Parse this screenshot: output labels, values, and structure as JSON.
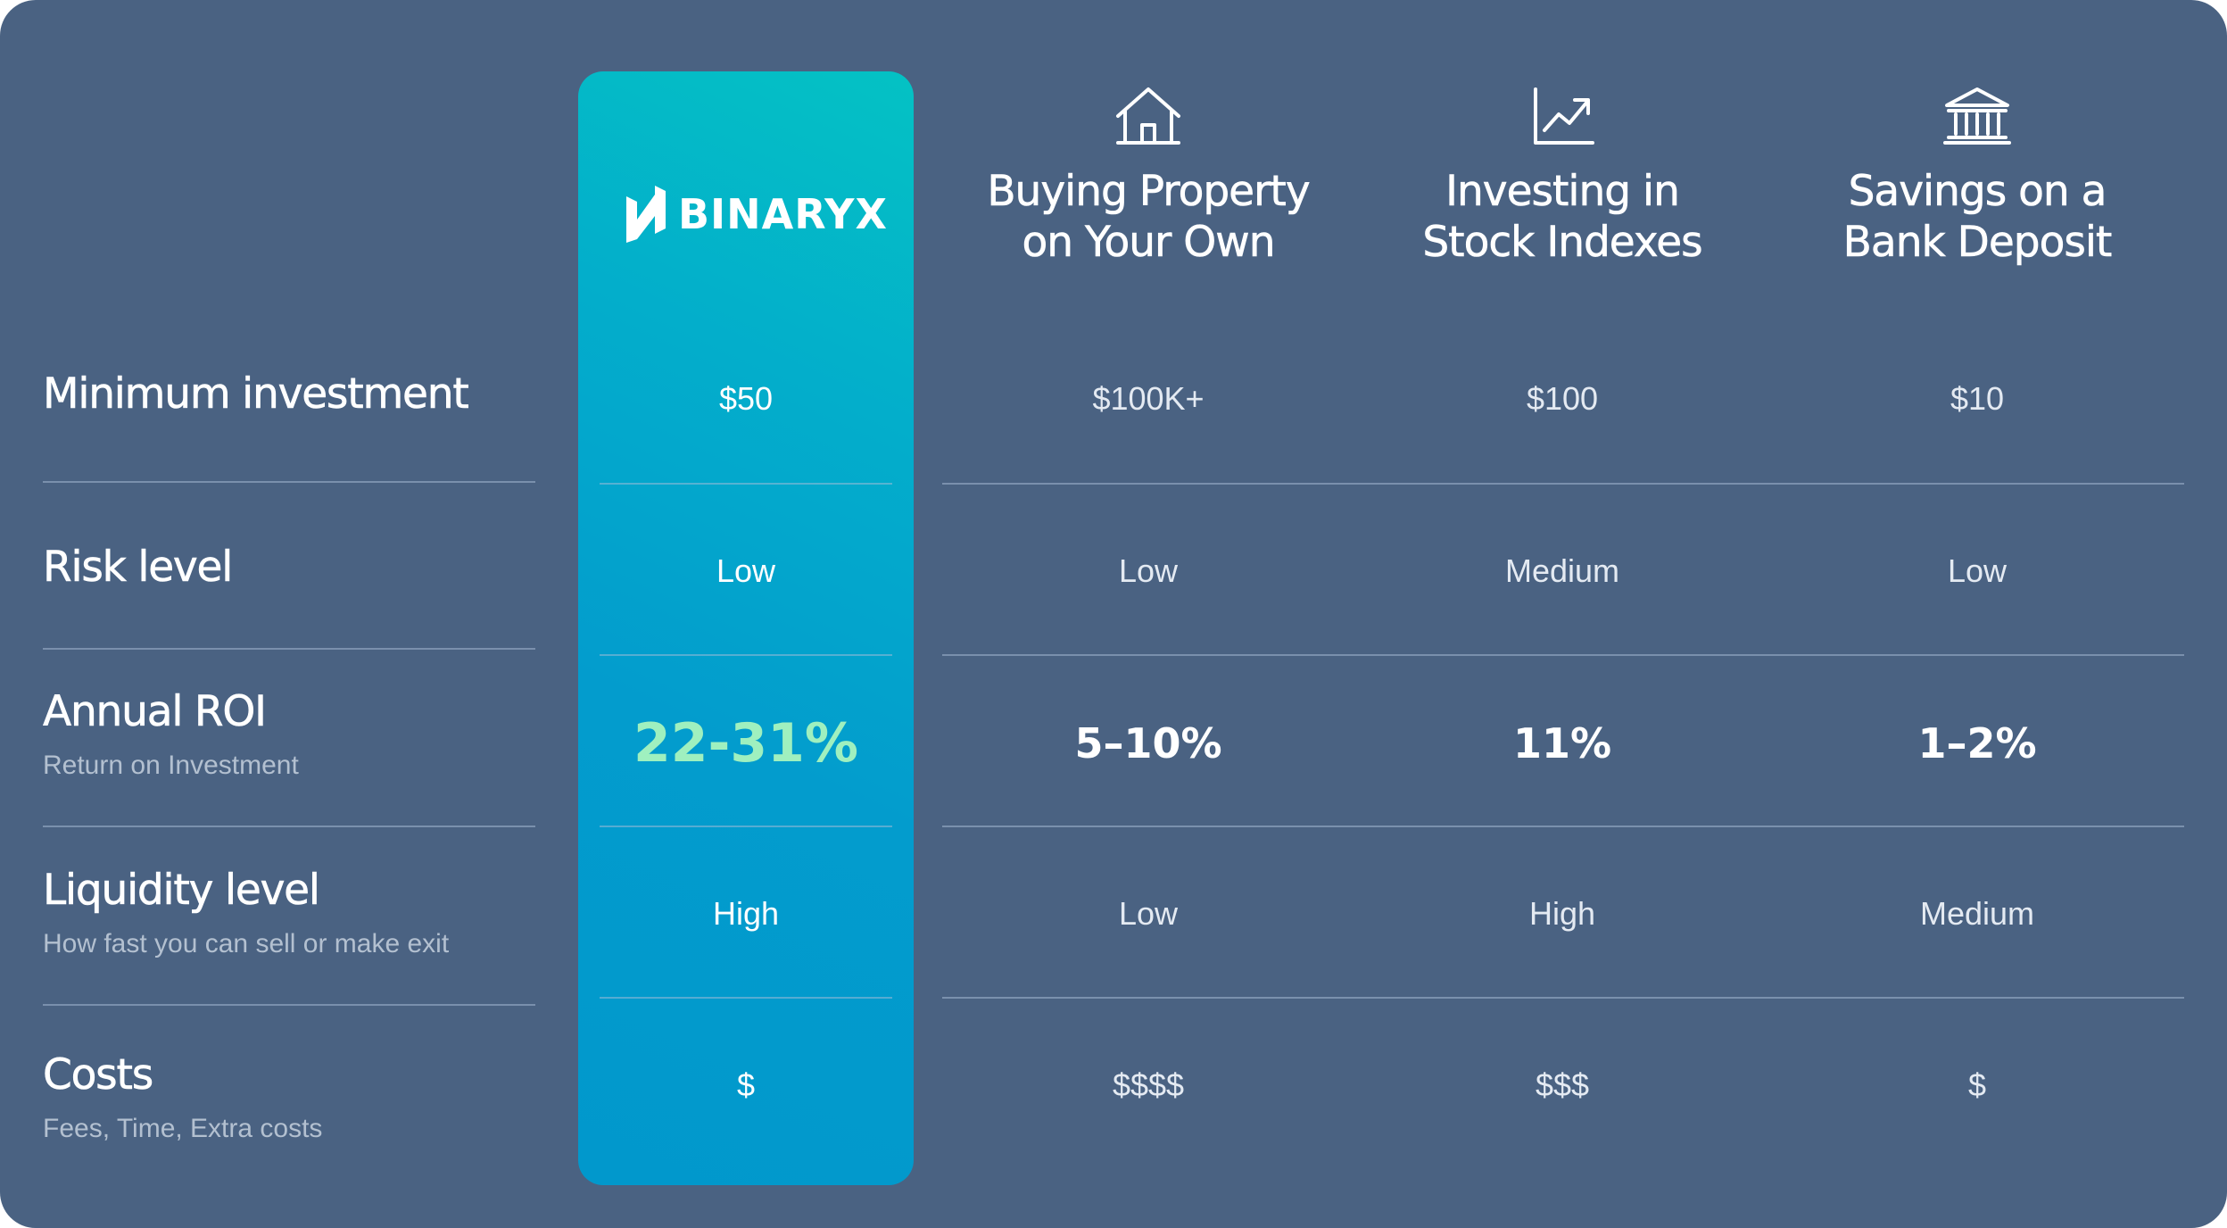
{
  "brand": {
    "name": "BINARYX",
    "icon": "binaryx-logo-icon"
  },
  "columns": [
    {
      "title_line1": "Buying Property",
      "title_line2": "on Your Own",
      "icon": "house-icon"
    },
    {
      "title_line1": "Investing in",
      "title_line2": "Stock Indexes",
      "icon": "chart-up-icon"
    },
    {
      "title_line1": "Savings on a",
      "title_line2": "Bank Deposit",
      "icon": "bank-icon"
    }
  ],
  "rows": [
    {
      "title": "Minimum investment",
      "subtitle": "",
      "values": [
        "$50",
        "$100K+",
        "$100",
        "$10"
      ]
    },
    {
      "title": "Risk level",
      "subtitle": "",
      "values": [
        "Low",
        "Low",
        "Medium",
        "Low"
      ]
    },
    {
      "title": "Annual ROI",
      "subtitle": "Return on Investment",
      "values": [
        "22-31%",
        "5–10%",
        "11%",
        "1–2%"
      ]
    },
    {
      "title": "Liquidity level",
      "subtitle": "How fast you can sell or make exit",
      "values": [
        "High",
        "Low",
        "High",
        "Medium"
      ]
    },
    {
      "title": "Costs",
      "subtitle": "Fees, Time, Extra costs",
      "values": [
        "$",
        "$$$$",
        "$$$",
        "$"
      ]
    }
  ],
  "colors": {
    "background": "#4a6282",
    "highlight_gradient_top": "#04c2c4",
    "highlight_gradient_bottom": "#0198cc",
    "roi_highlight": "#9ff0bf"
  }
}
